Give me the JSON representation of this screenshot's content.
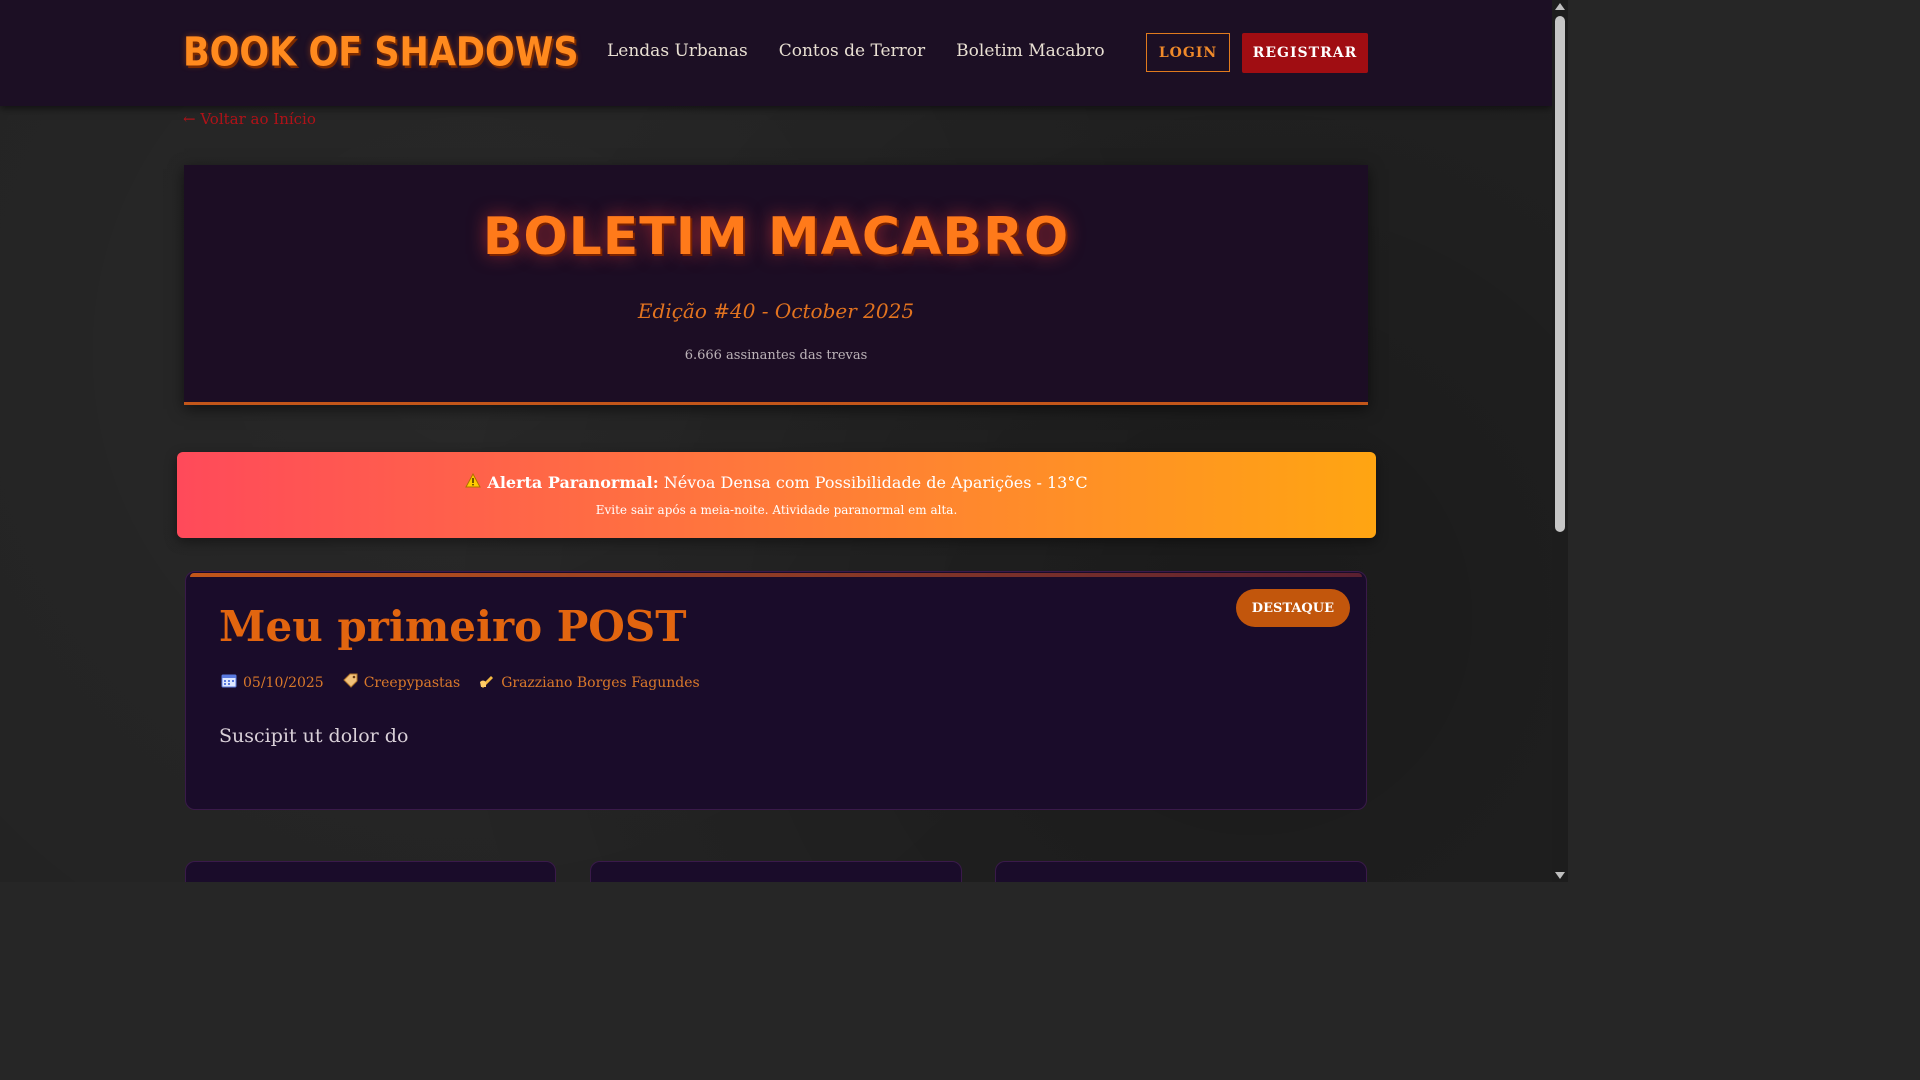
{
  "header": {
    "logo": "BOOK OF SHADOWS",
    "nav": [
      "Lendas Urbanas",
      "Contos de Terror",
      "Boletim Macabro"
    ],
    "login_label": "LOGIN",
    "register_label": "REGISTRAR"
  },
  "back_link": "← Voltar ao Início",
  "hero": {
    "title": "BOLETIM MACABRO",
    "edition": "Edição #40 - October 2025",
    "subscribers": "6.666 assinantes das trevas"
  },
  "alert": {
    "icon": "warning-icon",
    "label": "Alerta Paranormal:",
    "message": "Névoa Densa com Possibilidade de Aparições - 13°C",
    "sub": "Evite sair após a meia-noite. Atividade paranormal em alta."
  },
  "post": {
    "badge": "DESTAQUE",
    "title": "Meu primeiro POST",
    "date": "05/10/2025",
    "category": "Creepypastas",
    "author": "Grazziano Borges Fagundes",
    "excerpt": "Suscipit ut dolor do"
  },
  "colors": {
    "accent": "#e2650f",
    "brand_red": "#a00d12",
    "header_bg": "#1c0f24",
    "alert_start": "#ff4a5a",
    "alert_end": "#ffa512"
  }
}
